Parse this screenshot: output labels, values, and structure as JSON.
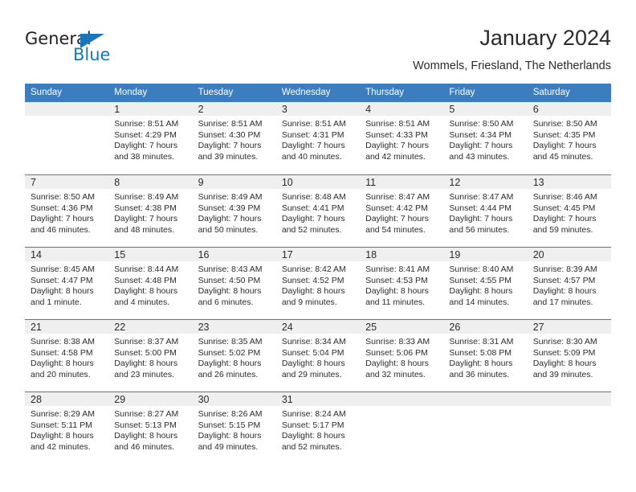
{
  "brand": {
    "name_part1": "General",
    "name_part2": "Blue",
    "triangle_color": "#1b75bb"
  },
  "header": {
    "month_title": "January 2024",
    "location": "Wommels, Friesland, The Netherlands"
  },
  "colors": {
    "header_blue": "#3c7dc0",
    "band_gray": "#efefef",
    "text": "#2b2b2b"
  },
  "weekday_headers": [
    "Sunday",
    "Monday",
    "Tuesday",
    "Wednesday",
    "Thursday",
    "Friday",
    "Saturday"
  ],
  "labels": {
    "sunrise_prefix": "Sunrise:",
    "sunset_prefix": "Sunset:",
    "daylight_prefix": "Daylight:"
  },
  "weeks": [
    {
      "days": [
        {
          "blank": true
        },
        {
          "day": "1",
          "sunrise": "Sunrise: 8:51 AM",
          "sunset": "Sunset: 4:29 PM",
          "daylight_line1": "Daylight: 7 hours",
          "daylight_line2": "and 38 minutes."
        },
        {
          "day": "2",
          "sunrise": "Sunrise: 8:51 AM",
          "sunset": "Sunset: 4:30 PM",
          "daylight_line1": "Daylight: 7 hours",
          "daylight_line2": "and 39 minutes."
        },
        {
          "day": "3",
          "sunrise": "Sunrise: 8:51 AM",
          "sunset": "Sunset: 4:31 PM",
          "daylight_line1": "Daylight: 7 hours",
          "daylight_line2": "and 40 minutes."
        },
        {
          "day": "4",
          "sunrise": "Sunrise: 8:51 AM",
          "sunset": "Sunset: 4:33 PM",
          "daylight_line1": "Daylight: 7 hours",
          "daylight_line2": "and 42 minutes."
        },
        {
          "day": "5",
          "sunrise": "Sunrise: 8:50 AM",
          "sunset": "Sunset: 4:34 PM",
          "daylight_line1": "Daylight: 7 hours",
          "daylight_line2": "and 43 minutes."
        },
        {
          "day": "6",
          "sunrise": "Sunrise: 8:50 AM",
          "sunset": "Sunset: 4:35 PM",
          "daylight_line1": "Daylight: 7 hours",
          "daylight_line2": "and 45 minutes."
        }
      ]
    },
    {
      "days": [
        {
          "day": "7",
          "sunrise": "Sunrise: 8:50 AM",
          "sunset": "Sunset: 4:36 PM",
          "daylight_line1": "Daylight: 7 hours",
          "daylight_line2": "and 46 minutes."
        },
        {
          "day": "8",
          "sunrise": "Sunrise: 8:49 AM",
          "sunset": "Sunset: 4:38 PM",
          "daylight_line1": "Daylight: 7 hours",
          "daylight_line2": "and 48 minutes."
        },
        {
          "day": "9",
          "sunrise": "Sunrise: 8:49 AM",
          "sunset": "Sunset: 4:39 PM",
          "daylight_line1": "Daylight: 7 hours",
          "daylight_line2": "and 50 minutes."
        },
        {
          "day": "10",
          "sunrise": "Sunrise: 8:48 AM",
          "sunset": "Sunset: 4:41 PM",
          "daylight_line1": "Daylight: 7 hours",
          "daylight_line2": "and 52 minutes."
        },
        {
          "day": "11",
          "sunrise": "Sunrise: 8:47 AM",
          "sunset": "Sunset: 4:42 PM",
          "daylight_line1": "Daylight: 7 hours",
          "daylight_line2": "and 54 minutes."
        },
        {
          "day": "12",
          "sunrise": "Sunrise: 8:47 AM",
          "sunset": "Sunset: 4:44 PM",
          "daylight_line1": "Daylight: 7 hours",
          "daylight_line2": "and 56 minutes."
        },
        {
          "day": "13",
          "sunrise": "Sunrise: 8:46 AM",
          "sunset": "Sunset: 4:45 PM",
          "daylight_line1": "Daylight: 7 hours",
          "daylight_line2": "and 59 minutes."
        }
      ]
    },
    {
      "days": [
        {
          "day": "14",
          "sunrise": "Sunrise: 8:45 AM",
          "sunset": "Sunset: 4:47 PM",
          "daylight_line1": "Daylight: 8 hours",
          "daylight_line2": "and 1 minute."
        },
        {
          "day": "15",
          "sunrise": "Sunrise: 8:44 AM",
          "sunset": "Sunset: 4:48 PM",
          "daylight_line1": "Daylight: 8 hours",
          "daylight_line2": "and 4 minutes."
        },
        {
          "day": "16",
          "sunrise": "Sunrise: 8:43 AM",
          "sunset": "Sunset: 4:50 PM",
          "daylight_line1": "Daylight: 8 hours",
          "daylight_line2": "and 6 minutes."
        },
        {
          "day": "17",
          "sunrise": "Sunrise: 8:42 AM",
          "sunset": "Sunset: 4:52 PM",
          "daylight_line1": "Daylight: 8 hours",
          "daylight_line2": "and 9 minutes."
        },
        {
          "day": "18",
          "sunrise": "Sunrise: 8:41 AM",
          "sunset": "Sunset: 4:53 PM",
          "daylight_line1": "Daylight: 8 hours",
          "daylight_line2": "and 11 minutes."
        },
        {
          "day": "19",
          "sunrise": "Sunrise: 8:40 AM",
          "sunset": "Sunset: 4:55 PM",
          "daylight_line1": "Daylight: 8 hours",
          "daylight_line2": "and 14 minutes."
        },
        {
          "day": "20",
          "sunrise": "Sunrise: 8:39 AM",
          "sunset": "Sunset: 4:57 PM",
          "daylight_line1": "Daylight: 8 hours",
          "daylight_line2": "and 17 minutes."
        }
      ]
    },
    {
      "days": [
        {
          "day": "21",
          "sunrise": "Sunrise: 8:38 AM",
          "sunset": "Sunset: 4:58 PM",
          "daylight_line1": "Daylight: 8 hours",
          "daylight_line2": "and 20 minutes."
        },
        {
          "day": "22",
          "sunrise": "Sunrise: 8:37 AM",
          "sunset": "Sunset: 5:00 PM",
          "daylight_line1": "Daylight: 8 hours",
          "daylight_line2": "and 23 minutes."
        },
        {
          "day": "23",
          "sunrise": "Sunrise: 8:35 AM",
          "sunset": "Sunset: 5:02 PM",
          "daylight_line1": "Daylight: 8 hours",
          "daylight_line2": "and 26 minutes."
        },
        {
          "day": "24",
          "sunrise": "Sunrise: 8:34 AM",
          "sunset": "Sunset: 5:04 PM",
          "daylight_line1": "Daylight: 8 hours",
          "daylight_line2": "and 29 minutes."
        },
        {
          "day": "25",
          "sunrise": "Sunrise: 8:33 AM",
          "sunset": "Sunset: 5:06 PM",
          "daylight_line1": "Daylight: 8 hours",
          "daylight_line2": "and 32 minutes."
        },
        {
          "day": "26",
          "sunrise": "Sunrise: 8:31 AM",
          "sunset": "Sunset: 5:08 PM",
          "daylight_line1": "Daylight: 8 hours",
          "daylight_line2": "and 36 minutes."
        },
        {
          "day": "27",
          "sunrise": "Sunrise: 8:30 AM",
          "sunset": "Sunset: 5:09 PM",
          "daylight_line1": "Daylight: 8 hours",
          "daylight_line2": "and 39 minutes."
        }
      ]
    },
    {
      "days": [
        {
          "day": "28",
          "sunrise": "Sunrise: 8:29 AM",
          "sunset": "Sunset: 5:11 PM",
          "daylight_line1": "Daylight: 8 hours",
          "daylight_line2": "and 42 minutes."
        },
        {
          "day": "29",
          "sunrise": "Sunrise: 8:27 AM",
          "sunset": "Sunset: 5:13 PM",
          "daylight_line1": "Daylight: 8 hours",
          "daylight_line2": "and 46 minutes."
        },
        {
          "day": "30",
          "sunrise": "Sunrise: 8:26 AM",
          "sunset": "Sunset: 5:15 PM",
          "daylight_line1": "Daylight: 8 hours",
          "daylight_line2": "and 49 minutes."
        },
        {
          "day": "31",
          "sunrise": "Sunrise: 8:24 AM",
          "sunset": "Sunset: 5:17 PM",
          "daylight_line1": "Daylight: 8 hours",
          "daylight_line2": "and 52 minutes."
        },
        {
          "blank": true
        },
        {
          "blank": true
        },
        {
          "blank": true
        }
      ]
    }
  ]
}
